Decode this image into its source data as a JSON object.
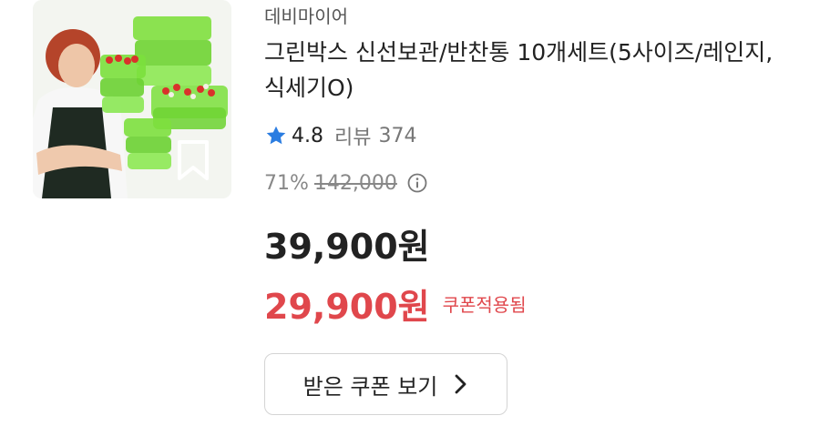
{
  "product": {
    "seller": "데비마이어",
    "title": "그린박스 신선보관/반찬통 10개세트(5사이즈/레인지,식세기O)",
    "image_icon": "product-photo",
    "bookmark_icon": "bookmark-icon"
  },
  "rating": {
    "star_icon": "star-icon",
    "value": "4.8",
    "review_label": "리뷰",
    "review_count": "374"
  },
  "pricing": {
    "discount_percent": "71%",
    "original_price": "142,000",
    "info_icon": "info-circle-icon",
    "price": "39,900원",
    "coupon_price": "29,900원",
    "coupon_applied_label": "쿠폰적용됨"
  },
  "coupon_button": {
    "label": "받은 쿠폰 보기",
    "icon": "chevron-right-icon"
  },
  "colors": {
    "accent_red": "#e0474c",
    "star_blue": "#2b7de1",
    "text_primary": "#222222",
    "text_muted": "#888888"
  }
}
